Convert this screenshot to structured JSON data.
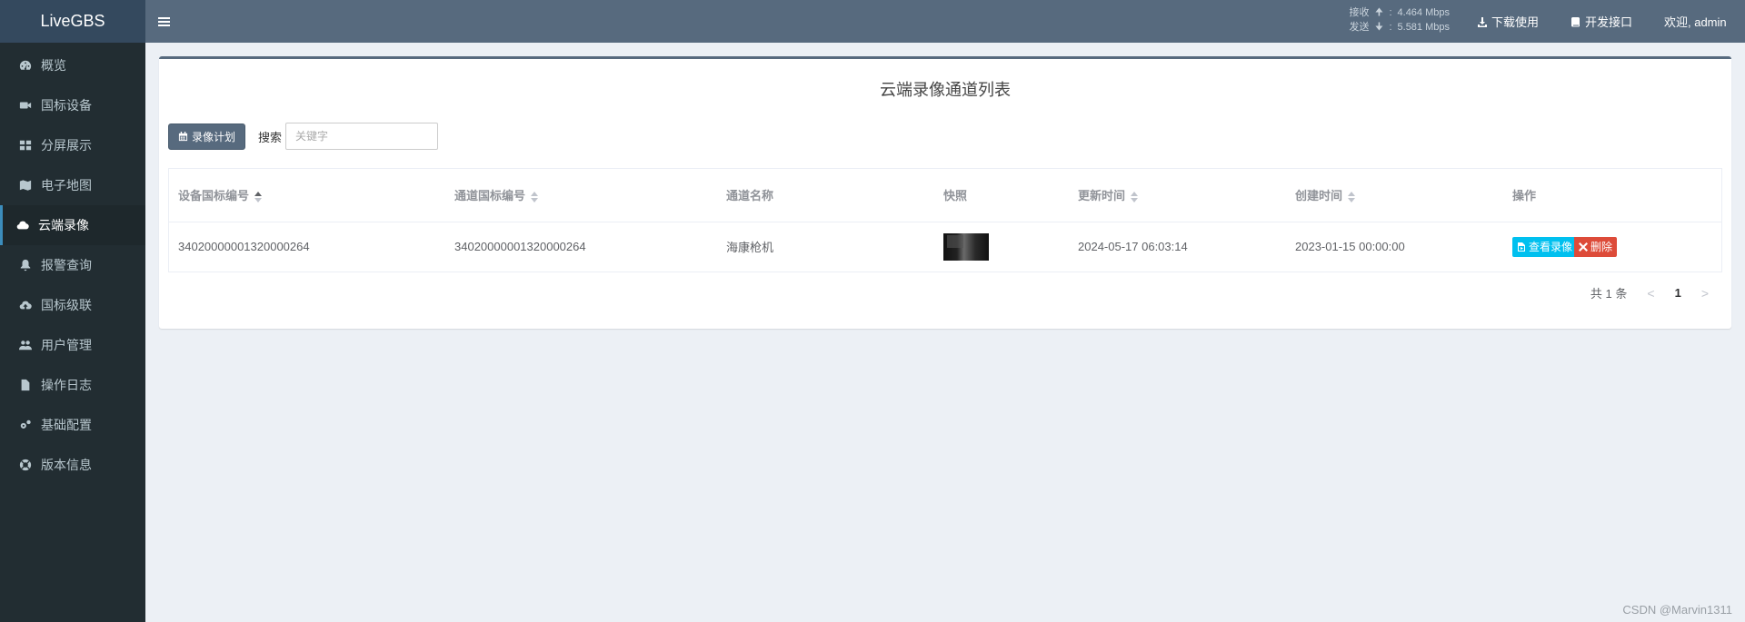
{
  "app": {
    "title": "LiveGBS"
  },
  "sidebar": {
    "items": [
      {
        "label": "概览",
        "icon": "dashboard-icon",
        "active": false
      },
      {
        "label": "国标设备",
        "icon": "video-camera-icon",
        "active": false
      },
      {
        "label": "分屏展示",
        "icon": "grid-icon",
        "active": false
      },
      {
        "label": "电子地图",
        "icon": "map-icon",
        "active": false
      },
      {
        "label": "云端录像",
        "icon": "cloud-icon",
        "active": true
      },
      {
        "label": "报警查询",
        "icon": "bell-icon",
        "active": false
      },
      {
        "label": "国标级联",
        "icon": "cloud-upload-icon",
        "active": false
      },
      {
        "label": "用户管理",
        "icon": "users-icon",
        "active": false
      },
      {
        "label": "操作日志",
        "icon": "file-icon",
        "active": false
      },
      {
        "label": "基础配置",
        "icon": "gears-icon",
        "active": false
      },
      {
        "label": "版本信息",
        "icon": "life-ring-icon",
        "active": false
      }
    ]
  },
  "header": {
    "rx_label": "接收",
    "rx_value": "4.464 Mbps",
    "tx_label": "发送",
    "tx_value": "5.581 Mbps",
    "download_label": "下载使用",
    "api_label": "开发接口",
    "welcome_label": "欢迎, admin"
  },
  "main": {
    "title": "云端录像通道列表",
    "plan_button": "录像计划",
    "search_label": "搜索",
    "search_placeholder": "关键字",
    "columns": [
      "设备国标编号",
      "通道国标编号",
      "通道名称",
      "快照",
      "更新时间",
      "创建时间",
      "操作"
    ],
    "rows": [
      {
        "device_id": "34020000001320000264",
        "channel_id": "34020000001320000264",
        "channel_name": "海康枪机",
        "updated": "2024-05-17 06:03:14",
        "created": "2023-01-15 00:00:00",
        "view_label": "查看录像",
        "delete_label": "删除"
      }
    ],
    "pager": {
      "total": "共 1 条",
      "page": "1",
      "prev": "<",
      "next": ">"
    }
  },
  "watermark": "CSDN @Marvin1311",
  "colors": {
    "header": "#576a7e",
    "sidebar": "#222d32",
    "view_btn": "#00c0ef",
    "delete_btn": "#dd4b39"
  }
}
